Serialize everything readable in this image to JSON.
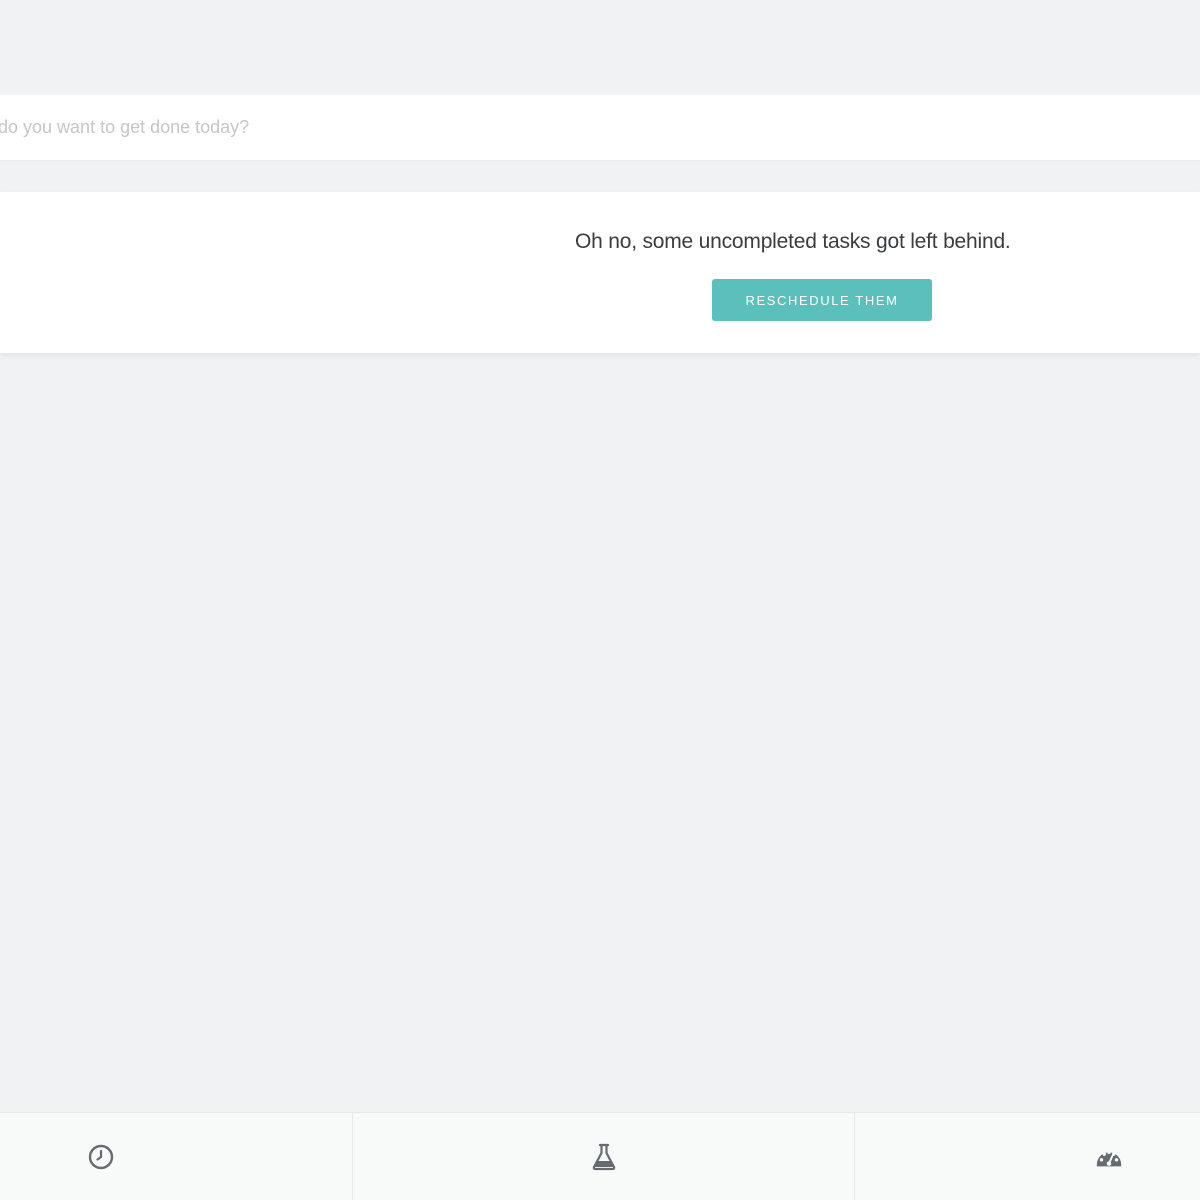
{
  "task_input": {
    "placeholder": "do you want to get done today?",
    "value": ""
  },
  "notice": {
    "message": "Oh no, some uncompleted tasks got left behind.",
    "button_label": "RESCHEDULE THEM"
  },
  "bottom_nav": {
    "tabs": [
      {
        "icon": "clock-icon"
      },
      {
        "icon": "flask-icon"
      },
      {
        "icon": "dashboard-icon"
      }
    ]
  },
  "colors": {
    "background": "#f1f2f4",
    "accent": "#5bbfbb",
    "icon": "#666b70"
  }
}
